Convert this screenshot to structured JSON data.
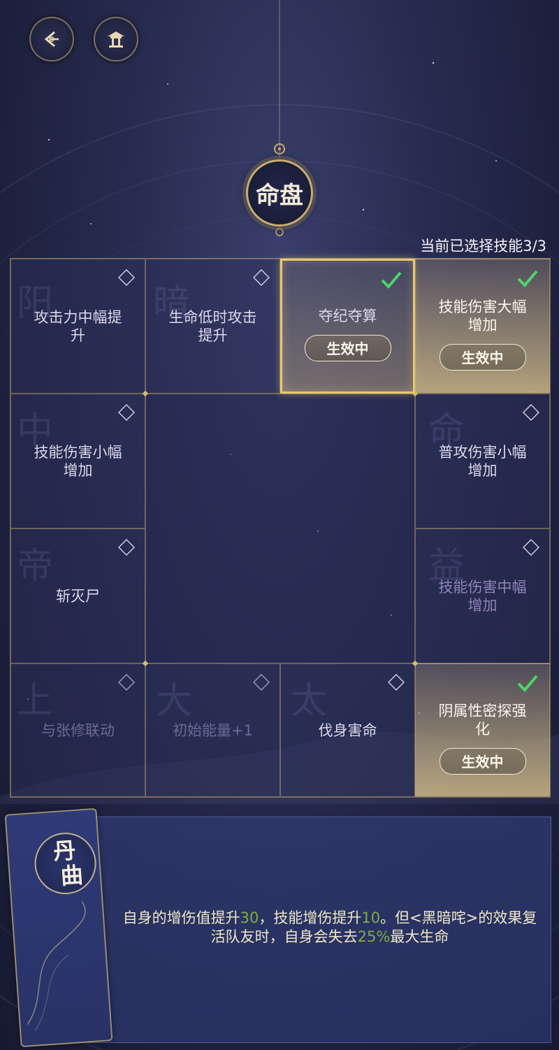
{
  "header": {
    "back_icon": "back-arrow-icon",
    "home_icon": "pavilion-icon",
    "emblem_text": "命盘"
  },
  "selection": {
    "count_label": "当前已选择技能3/3"
  },
  "cells": {
    "c00": {
      "label": "攻击力中幅提\n升",
      "state": "unselected"
    },
    "c01": {
      "label": "生命低时攻击\n提升",
      "state": "unselected"
    },
    "c02": {
      "label": "夺纪夺算",
      "state": "active",
      "badge": "生效中"
    },
    "c03": {
      "label": "技能伤害大幅\n增加",
      "state": "active",
      "badge": "生效中"
    },
    "c10": {
      "label": "技能伤害小幅\n增加",
      "state": "unselected"
    },
    "c13": {
      "label": "普攻伤害小幅\n增加",
      "state": "unselected"
    },
    "c20": {
      "label": "斩灭尸",
      "state": "unselected"
    },
    "c23": {
      "label": "技能伤害中幅\n增加",
      "state": "locked"
    },
    "c30": {
      "label": "与张修联动",
      "state": "locked"
    },
    "c31": {
      "label": "初始能量+1",
      "state": "locked"
    },
    "c32": {
      "label": "伐身害命",
      "state": "unselected"
    },
    "c33": {
      "label": "阴属性密探强\n化",
      "state": "active",
      "badge": "生效中"
    }
  },
  "detail": {
    "star_name_1": "丹",
    "star_name_2": "曲",
    "desc_p1": "自身的增伤值提升",
    "desc_v1": "30",
    "desc_p2": "，技能增伤提升",
    "desc_v2": "10",
    "desc_p3": "。但<黑暗咤>的效果复活队友时，自身会失去",
    "desc_v3": "25%",
    "desc_p4": "最大生命"
  },
  "colors": {
    "gold": "#c9ad6e",
    "highlight_green": "#7fae3c",
    "check_green": "#4cd66a"
  }
}
